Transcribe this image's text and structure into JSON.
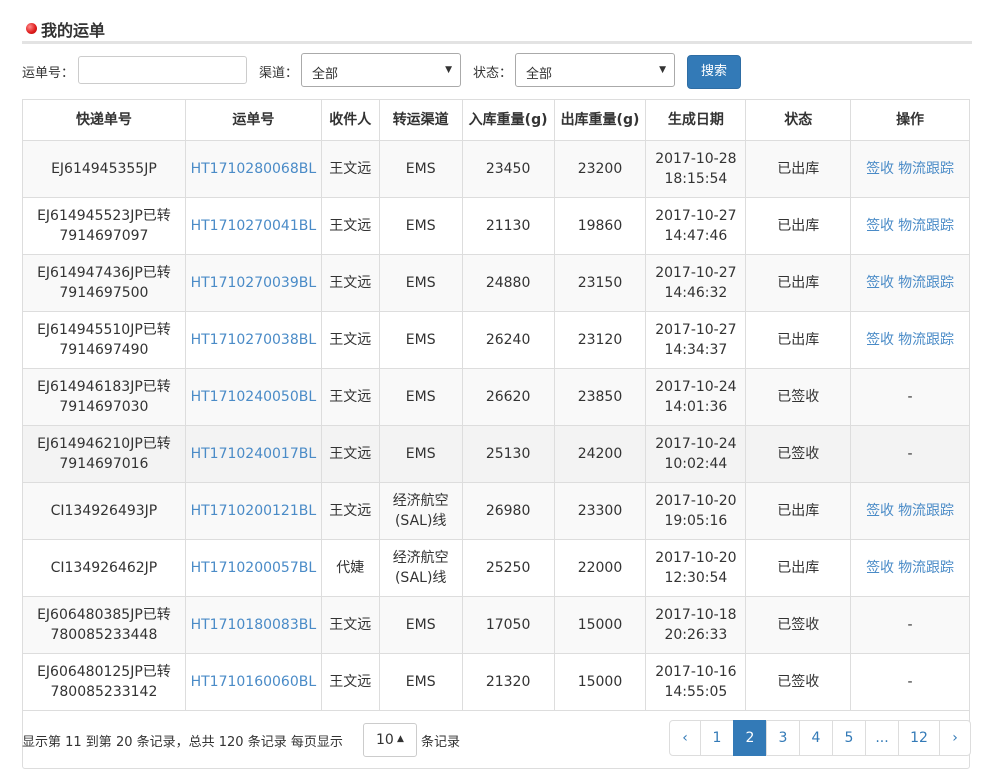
{
  "panel": {
    "title": "我的运单"
  },
  "filters": {
    "waybill_label": "运单号：",
    "waybill_value": "",
    "channel_label": "渠道：",
    "channel_value": "全部",
    "status_label": "状态：",
    "status_value": "全部",
    "search_label": "搜索"
  },
  "table": {
    "headers": [
      "快递单号",
      "运单号",
      "收件人",
      "转运渠道",
      "入库重量(g)",
      "出库重量(g)",
      "生成日期",
      "状态",
      "操作"
    ],
    "rows": [
      {
        "express": [
          "EJ614945355JP",
          ""
        ],
        "waybill": "HT1710280068BL",
        "recipient": "王文远",
        "channel": [
          "EMS",
          ""
        ],
        "in_weight": "23450",
        "out_weight": "23200",
        "date": [
          "2017-10-28",
          "18:15:54"
        ],
        "status": "已出库",
        "actions": [
          "签收",
          "物流跟踪"
        ],
        "dash": ""
      },
      {
        "express": [
          "EJ614945523JP已转",
          "7914697097"
        ],
        "waybill": "HT1710270041BL",
        "recipient": "王文远",
        "channel": [
          "EMS",
          ""
        ],
        "in_weight": "21130",
        "out_weight": "19860",
        "date": [
          "2017-10-27",
          "14:47:46"
        ],
        "status": "已出库",
        "actions": [
          "签收",
          "物流跟踪"
        ],
        "dash": ""
      },
      {
        "express": [
          "EJ614947436JP已转",
          "7914697500"
        ],
        "waybill": "HT1710270039BL",
        "recipient": "王文远",
        "channel": [
          "EMS",
          ""
        ],
        "in_weight": "24880",
        "out_weight": "23150",
        "date": [
          "2017-10-27",
          "14:46:32"
        ],
        "status": "已出库",
        "actions": [
          "签收",
          "物流跟踪"
        ],
        "dash": ""
      },
      {
        "express": [
          "EJ614945510JP已转",
          "7914697490"
        ],
        "waybill": "HT1710270038BL",
        "recipient": "王文远",
        "channel": [
          "EMS",
          ""
        ],
        "in_weight": "26240",
        "out_weight": "23120",
        "date": [
          "2017-10-27",
          "14:34:37"
        ],
        "status": "已出库",
        "actions": [
          "签收",
          "物流跟踪"
        ],
        "dash": ""
      },
      {
        "express": [
          "EJ614946183JP已转",
          "7914697030"
        ],
        "waybill": "HT1710240050BL",
        "recipient": "王文远",
        "channel": [
          "EMS",
          ""
        ],
        "in_weight": "26620",
        "out_weight": "23850",
        "date": [
          "2017-10-24",
          "14:01:36"
        ],
        "status": "已签收",
        "actions": [],
        "dash": "-"
      },
      {
        "express": [
          "EJ614946210JP已转",
          "7914697016"
        ],
        "waybill": "HT1710240017BL",
        "recipient": "王文远",
        "channel": [
          "EMS",
          ""
        ],
        "in_weight": "25130",
        "out_weight": "24200",
        "date": [
          "2017-10-24",
          "10:02:44"
        ],
        "status": "已签收",
        "actions": [],
        "dash": "-"
      },
      {
        "express": [
          "CI134926493JP",
          ""
        ],
        "waybill": "HT1710200121BL",
        "recipient": "王文远",
        "channel": [
          "经济航空",
          "(SAL)线"
        ],
        "in_weight": "26980",
        "out_weight": "23300",
        "date": [
          "2017-10-20",
          "19:05:16"
        ],
        "status": "已出库",
        "actions": [
          "签收",
          "物流跟踪"
        ],
        "dash": ""
      },
      {
        "express": [
          "CI134926462JP",
          ""
        ],
        "waybill": "HT1710200057BL",
        "recipient": "代婕",
        "channel": [
          "经济航空",
          "(SAL)线"
        ],
        "in_weight": "25250",
        "out_weight": "22000",
        "date": [
          "2017-10-20",
          "12:30:54"
        ],
        "status": "已出库",
        "actions": [
          "签收",
          "物流跟踪"
        ],
        "dash": ""
      },
      {
        "express": [
          "EJ606480385JP已转",
          "780085233448"
        ],
        "waybill": "HT1710180083BL",
        "recipient": "王文远",
        "channel": [
          "EMS",
          ""
        ],
        "in_weight": "17050",
        "out_weight": "15000",
        "date": [
          "2017-10-18",
          "20:26:33"
        ],
        "status": "已签收",
        "actions": [],
        "dash": "-"
      },
      {
        "express": [
          "EJ606480125JP已转",
          "780085233142"
        ],
        "waybill": "HT1710160060BL",
        "recipient": "王文远",
        "channel": [
          "EMS",
          ""
        ],
        "in_weight": "21320",
        "out_weight": "15000",
        "date": [
          "2017-10-16",
          "14:55:05"
        ],
        "status": "已签收",
        "actions": [],
        "dash": "-"
      }
    ]
  },
  "footer": {
    "info_prefix": "显示第 11 到第 20 条记录，总共 120 条记录 每页显示",
    "page_size": "10",
    "info_suffix": "条记录"
  },
  "pagination": {
    "items": [
      {
        "label": "‹",
        "name": "pagination-prev"
      },
      {
        "label": "1",
        "name": "pagination-page-1"
      },
      {
        "label": "2",
        "name": "pagination-page-2",
        "active": true
      },
      {
        "label": "3",
        "name": "pagination-page-3"
      },
      {
        "label": "4",
        "name": "pagination-page-4"
      },
      {
        "label": "5",
        "name": "pagination-page-5"
      },
      {
        "label": "...",
        "name": "pagination-ellipsis"
      },
      {
        "label": "12",
        "name": "pagination-page-12"
      },
      {
        "label": "›",
        "name": "pagination-next"
      }
    ]
  },
  "colors": {
    "accent": "#337ab7",
    "link": "#4a8bc7",
    "title_dot": "#e02020"
  }
}
